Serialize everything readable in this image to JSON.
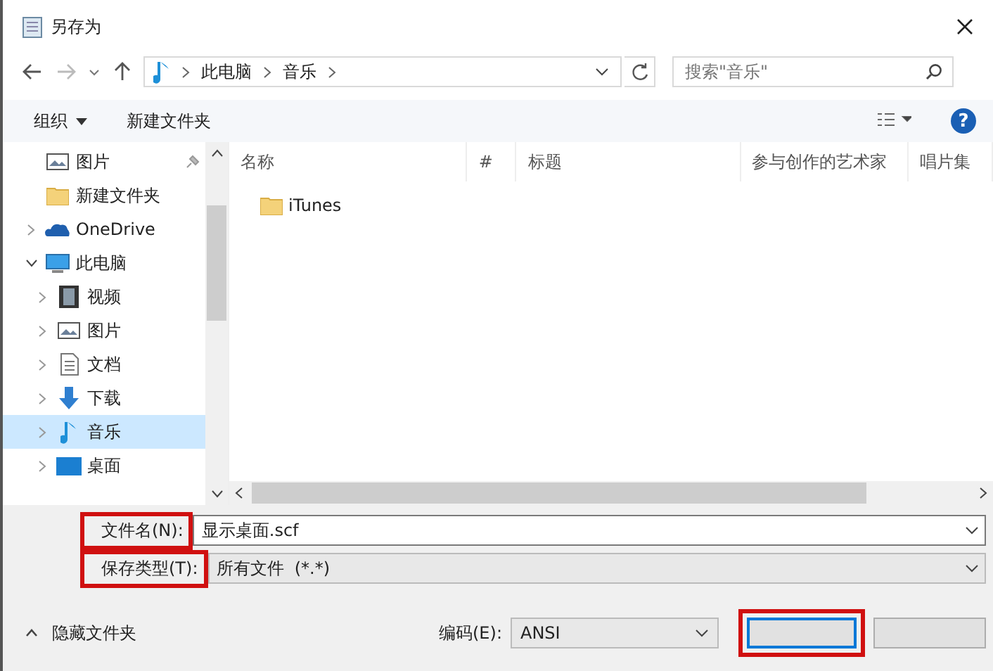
{
  "window": {
    "title": "另存为"
  },
  "address": {
    "segments": [
      "此电脑",
      "音乐"
    ]
  },
  "search": {
    "placeholder": "搜索\"音乐\""
  },
  "toolbar": {
    "organize": "组织",
    "new_folder": "新建文件夹",
    "help": "?"
  },
  "sidebar": {
    "items": [
      {
        "label": "图片",
        "kind": "picture",
        "pinned": true
      },
      {
        "label": "新建文件夹",
        "kind": "folder",
        "pinned": false
      },
      {
        "label": "OneDrive",
        "kind": "cloud",
        "expanded": false,
        "selected": false
      },
      {
        "label": "此电脑",
        "kind": "pc",
        "expanded": true,
        "selected": false,
        "children": [
          {
            "label": "视频",
            "kind": "video",
            "expanded": false,
            "selected": false
          },
          {
            "label": "图片",
            "kind": "picture",
            "expanded": false,
            "selected": false
          },
          {
            "label": "文档",
            "kind": "doc",
            "expanded": false,
            "selected": false
          },
          {
            "label": "下载",
            "kind": "download",
            "expanded": false,
            "selected": false
          },
          {
            "label": "音乐",
            "kind": "music",
            "expanded": false,
            "selected": true
          },
          {
            "label": "桌面",
            "kind": "desktop",
            "expanded": false,
            "selected": false
          }
        ]
      }
    ]
  },
  "table": {
    "columns": [
      "名称",
      "#",
      "标题",
      "参与创作的艺术家",
      "唱片集"
    ],
    "rows": [
      {
        "name": "iTunes"
      }
    ]
  },
  "form": {
    "file_name": {
      "label": "文件名(N):",
      "value": "显示桌面.scf",
      "highlighted": true
    },
    "file_type": {
      "label": "保存类型(T):",
      "value": "所有文件  (*.*)",
      "highlighted": true
    },
    "hide_folders": "隐藏文件夹",
    "encoding": {
      "label": "编码(E):",
      "value": "ANSI"
    },
    "save_button": {
      "highlighted": true
    }
  }
}
